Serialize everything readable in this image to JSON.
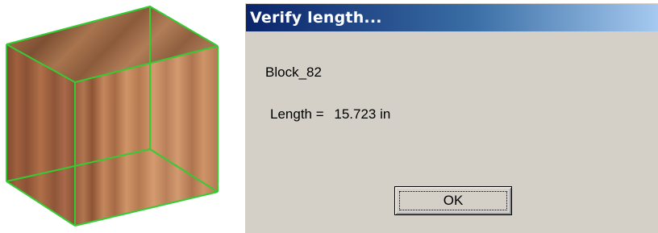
{
  "viewport": {
    "object": "wooden-block",
    "edge_highlight_color": "#33cc33"
  },
  "dialog": {
    "title": "Verify length...",
    "block_name": "Block_82",
    "length_label": "Length =",
    "length_value": "15.723 in",
    "ok_label": "OK",
    "titlebar_colors": [
      "#0a246a",
      "#a6caf0"
    ]
  }
}
